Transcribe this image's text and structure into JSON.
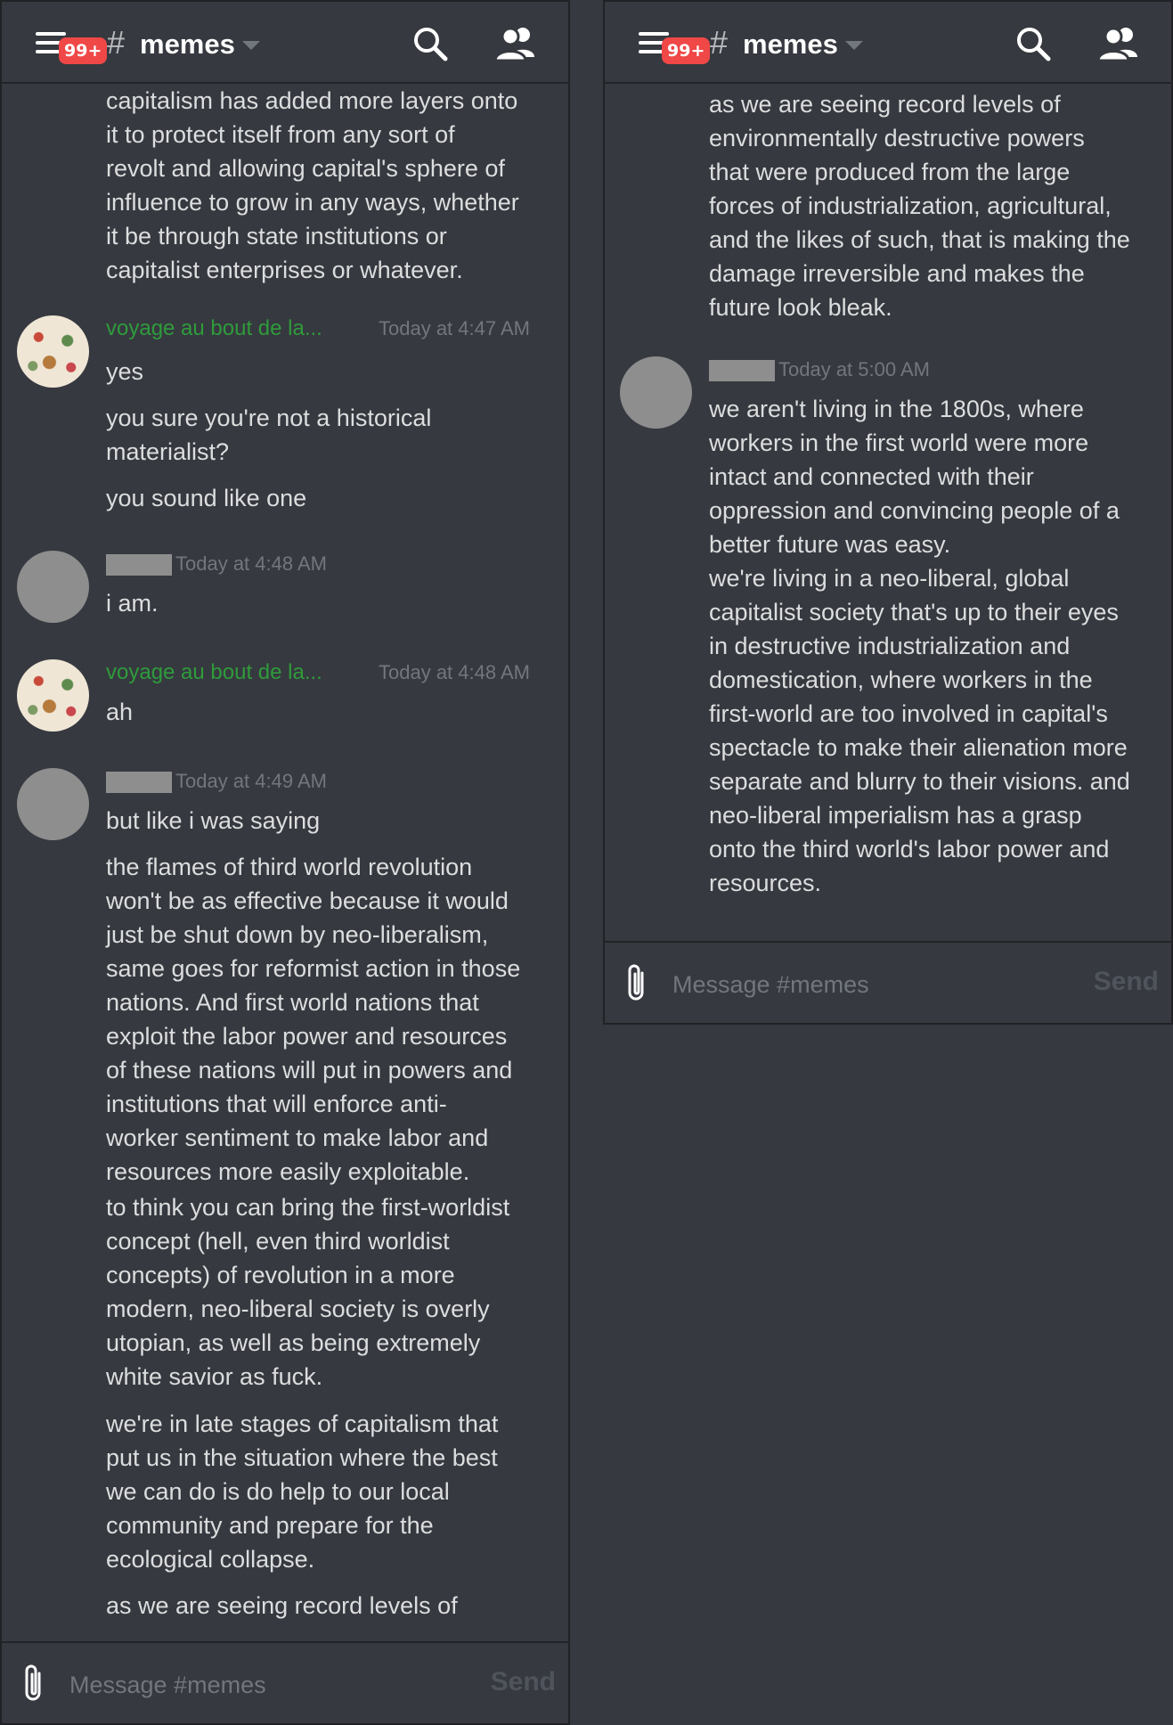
{
  "header": {
    "badge": "99+",
    "hash": "#",
    "channel_name": "memes"
  },
  "icons": {
    "menu": "hamburger-menu-icon",
    "search": "search-icon",
    "members": "members-icon",
    "attach": "paperclip-icon",
    "dropdown": "chevron-down-icon"
  },
  "colors": {
    "background": "#36393f",
    "badge": "#f04747",
    "author_green": "#2f9b3c",
    "timestamp": "#72767d",
    "text": "#dcddde"
  },
  "left_panel": {
    "messages": [
      {
        "text": "capitalism has added more layers onto\nit to protect itself from any sort of\nrevolt and allowing capital's sphere of\ninfluence to grow in any ways, whether\nit be through state institutions or\ncapitalist enterprises or whatever."
      },
      {
        "author": "voyage au bout de la...",
        "timestamp": "Today at 4:47 AM",
        "lines": [
          "yes",
          "you sure you're not a historical\nmaterialist?",
          "you sound like one"
        ]
      },
      {
        "author": "",
        "timestamp": "Today at 4:48 AM",
        "lines": [
          "i am."
        ]
      },
      {
        "author": "voyage au bout de la...",
        "timestamp": "Today at 4:48 AM",
        "lines": [
          "ah"
        ]
      },
      {
        "author": "",
        "timestamp": "Today at 4:49 AM",
        "lines": [
          "but like i was saying",
          "the flames of third world revolution\nwon't be as effective because it would\njust be shut down by neo-liberalism,\nsame goes for reformist action in those\nnations. And first world nations that\nexploit the labor power and resources\nof these nations will put in powers and\ninstitutions that will enforce anti-\nworker sentiment to make labor and\nresources more easily exploitable.",
          "to think you can bring the first-worldist\nconcept (hell, even third worldist\nconcepts) of revolution in a more\nmodern, neo-liberal society is overly\nutopian, as well as being extremely\nwhite savior as fuck.",
          "we're in late stages of capitalism that\nput us in the situation where the best\nwe can do is do help to our local\ncommunity and prepare for the\necological collapse.",
          "as we are seeing record levels of"
        ]
      }
    ]
  },
  "right_panel": {
    "messages": [
      {
        "text": "as we are seeing record levels of\nenvironmentally destructive powers\nthat were produced from the large\nforces of industrialization, agricultural,\nand the likes of such, that is making the\ndamage irreversible and makes the\nfuture look bleak."
      },
      {
        "author": "",
        "timestamp": "Today at 5:00 AM",
        "lines": [
          "we aren't living in the 1800s, where\nworkers in the first world were more\nintact and connected with their\noppression and convincing people of a\nbetter future was easy.\nwe're living in a neo-liberal, global\ncapitalist society that's up to their eyes\nin destructive industrialization and\ndomestication, where workers in the\nfirst-world are too involved in capital's\nspectacle to make their alienation more\nseparate and blurry to their visions. and\nneo-liberal imperialism has a grasp\nonto the third world's labor power and\nresources."
        ]
      }
    ]
  },
  "composer": {
    "placeholder": "Message #memes",
    "value": "",
    "send_label": "Send"
  }
}
